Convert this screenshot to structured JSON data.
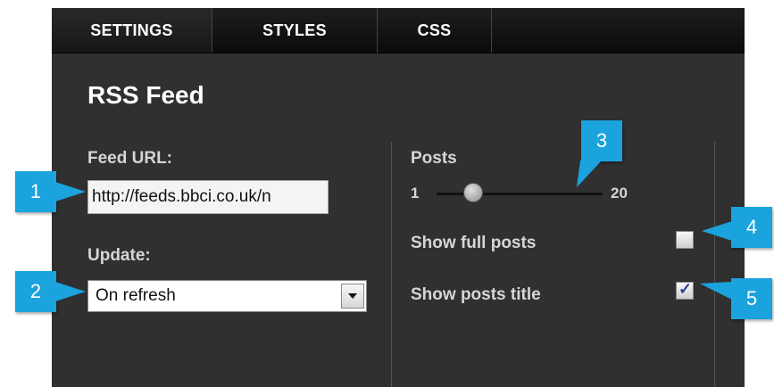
{
  "tabs": [
    {
      "label": "SETTINGS",
      "active": true
    },
    {
      "label": "STYLES",
      "active": false
    },
    {
      "label": "CSS",
      "active": false
    }
  ],
  "title": "RSS Feed",
  "feed_url": {
    "label": "Feed URL:",
    "value": "http://feeds.bbci.co.uk/n"
  },
  "update": {
    "label": "Update:",
    "selected": "On refresh"
  },
  "posts": {
    "label": "Posts",
    "min_label": "1",
    "max_label": "20",
    "value_fraction": 0.22
  },
  "options": {
    "show_full_posts": {
      "label": "Show full posts",
      "checked": false
    },
    "show_posts_title": {
      "label": "Show posts title",
      "checked": true
    }
  },
  "callouts": [
    "1",
    "2",
    "3",
    "4",
    "5"
  ],
  "colors": {
    "panel_bg": "#303030",
    "tabbar_bg": "#0b0b0b",
    "callout_bg": "#1aa3dd",
    "checkmark": "#2c3c9c"
  }
}
